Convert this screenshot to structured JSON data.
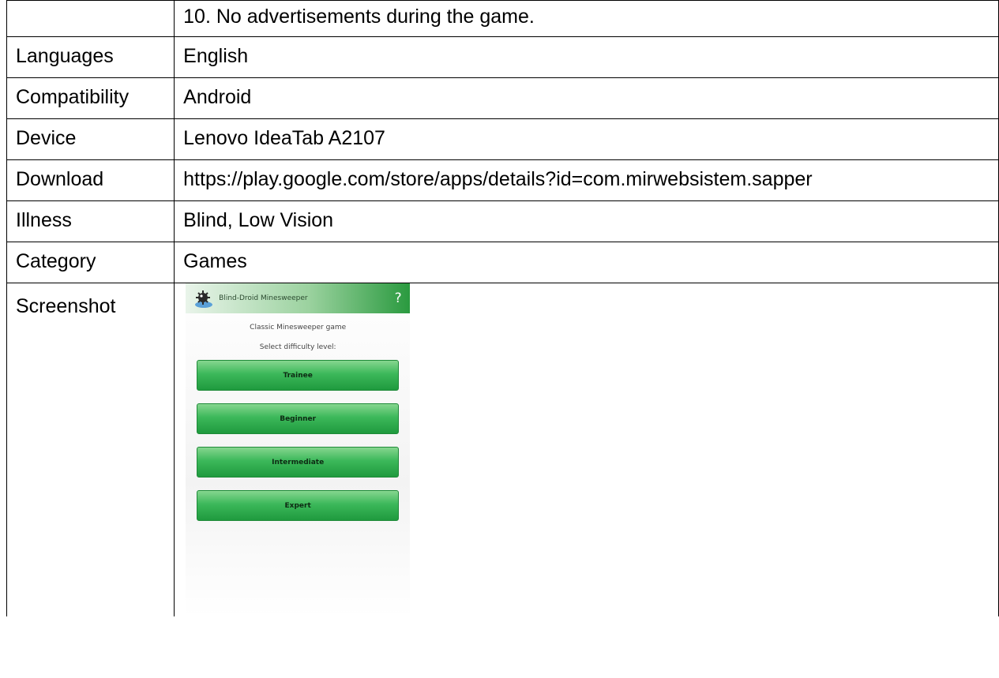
{
  "rows": [
    {
      "label": "",
      "value": "10. No advertisements during the game."
    },
    {
      "label": "Languages",
      "value": "English"
    },
    {
      "label": "Compatibility",
      "value": "Android"
    },
    {
      "label": "Device",
      "value": "Lenovo IdeaTab A2107"
    },
    {
      "label": "Download",
      "value": "https://play.google.com/store/apps/details?id=com.mirwebsistem.sapper"
    },
    {
      "label": "Illness",
      "value": "Blind, Low Vision"
    },
    {
      "label": "Category",
      "value": "Games"
    },
    {
      "label": "Screenshot",
      "value": ""
    }
  ],
  "app_screenshot": {
    "app_title": "Blind-Droid Minesweeper",
    "help_icon": "?",
    "subtitle": "Classic Minesweeper game",
    "prompt": "Select difficulty level:",
    "buttons": [
      "Trainee",
      "Beginner",
      "Intermediate",
      "Expert"
    ],
    "colors": {
      "accent": "#1f9a3e",
      "appbar_end": "#2a9a3f"
    },
    "icons": {
      "logo": "minesweeper-logo-icon",
      "help": "help-icon"
    }
  }
}
